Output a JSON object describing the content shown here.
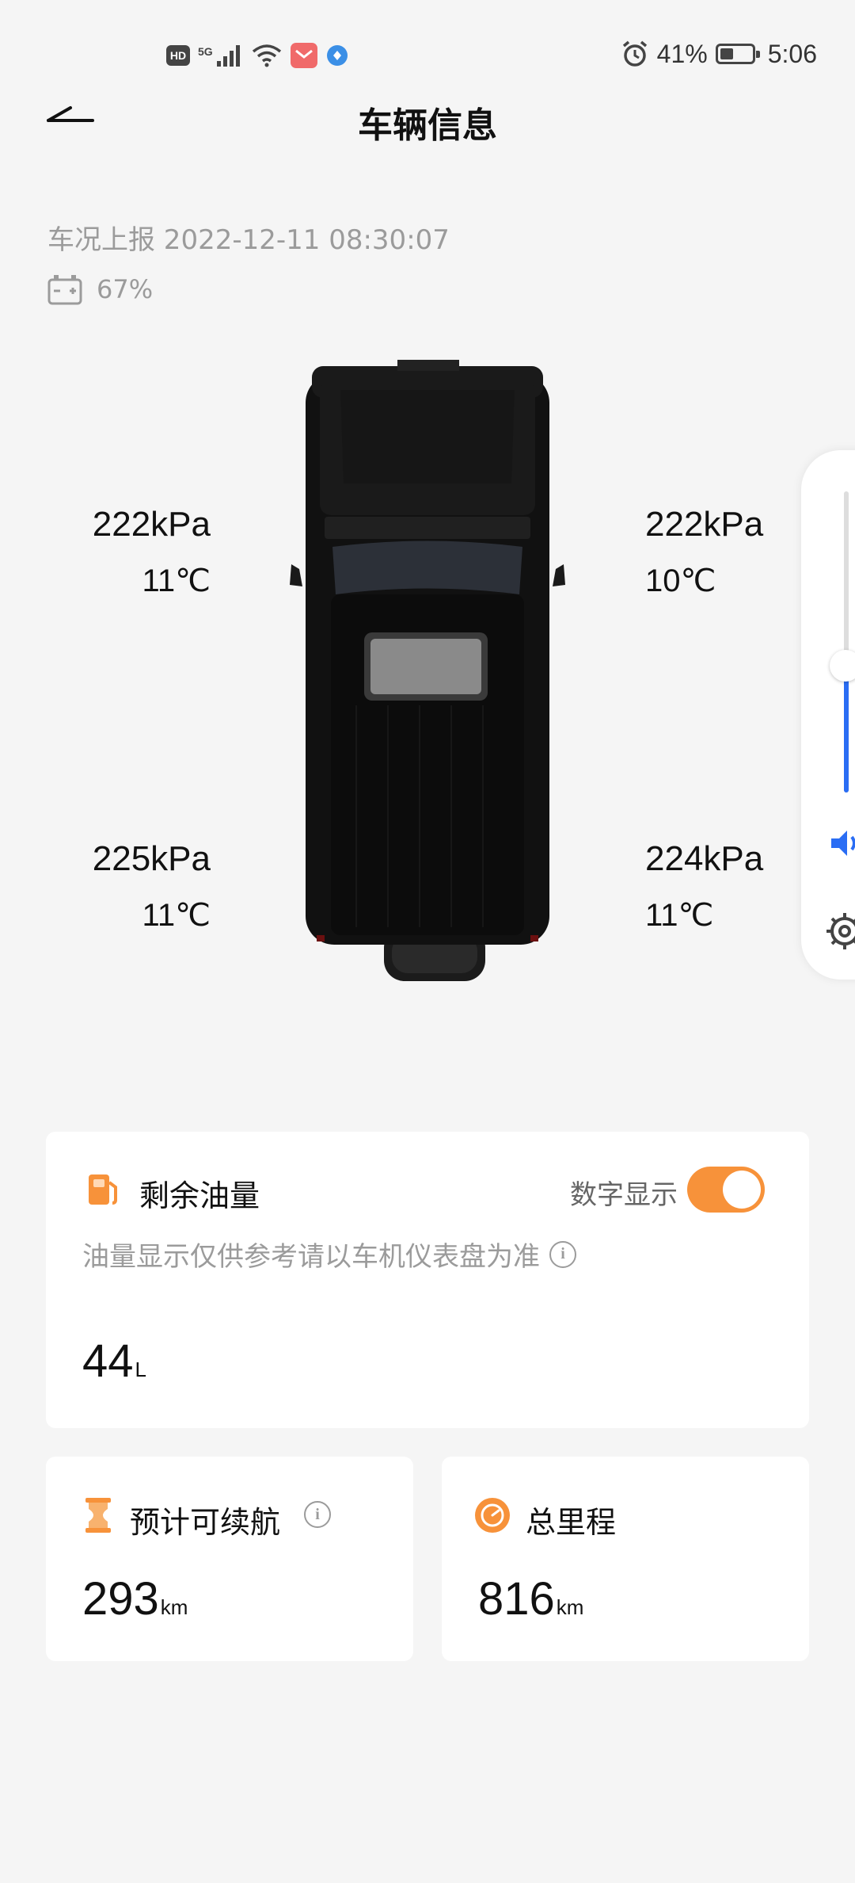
{
  "status_bar": {
    "hd_label": "HD",
    "network_label": "5G",
    "battery_percent": "41%",
    "battery_level": 0.41,
    "time": "5:06"
  },
  "header": {
    "title": "车辆信息"
  },
  "report": {
    "text": "车况上报 2022-12-11 08:30:07",
    "battery_percent": "67%"
  },
  "tires": {
    "front_left": {
      "pressure": "222kPa",
      "temp": "11℃"
    },
    "front_right": {
      "pressure": "222kPa",
      "temp": "10℃"
    },
    "rear_left": {
      "pressure": "225kPa",
      "temp": "11℃"
    },
    "rear_right": {
      "pressure": "224kPa",
      "temp": "11℃"
    }
  },
  "side_panel": {
    "volume_level": 0.42
  },
  "fuel": {
    "title": "剩余油量",
    "digital_label": "数字显示",
    "digital_on": true,
    "note": "油量显示仅供参考请以车机仪表盘为准",
    "value": "44",
    "unit": "L"
  },
  "range": {
    "title": "预计可续航",
    "value": "293",
    "unit": "km"
  },
  "odometer": {
    "title": "总里程",
    "value": "816",
    "unit": "km"
  },
  "colors": {
    "accent_orange": "#f7923a",
    "slider_blue": "#2a6df4",
    "muted_text": "#9b9b9b"
  }
}
